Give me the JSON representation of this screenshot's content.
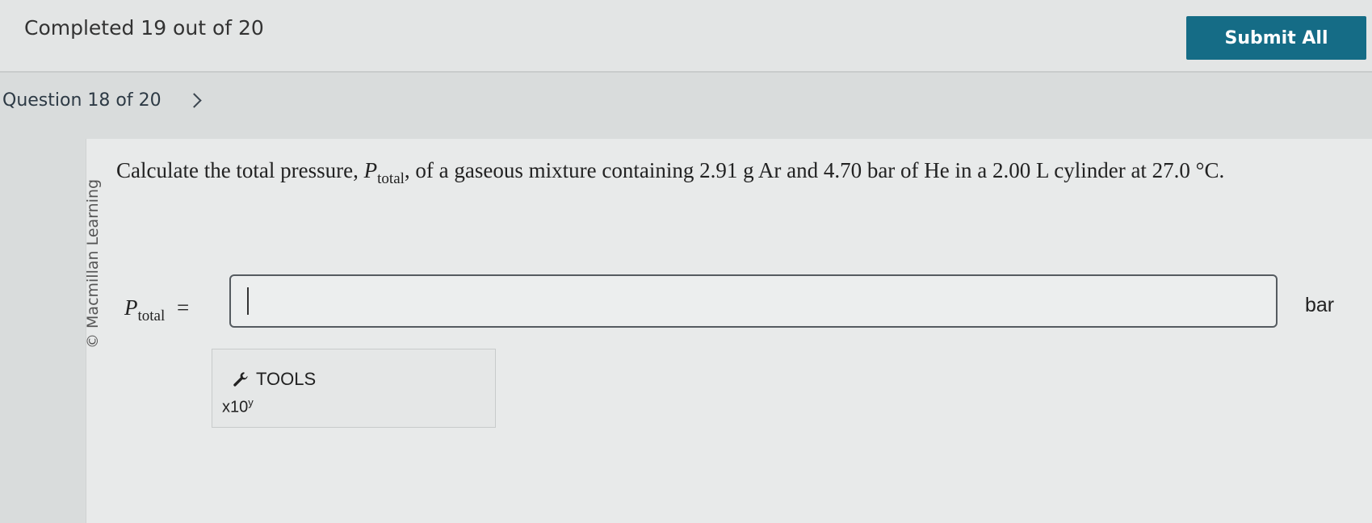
{
  "header": {
    "progress": "Completed 19 out of 20",
    "submit_label": "Submit All"
  },
  "nav": {
    "question_label": "Question 18 of 20",
    "next_icon": "chevron-right-icon"
  },
  "panel": {
    "copyright": "© Macmillan Learning",
    "question": {
      "before": "Calculate the total pressure, ",
      "symbol": "P",
      "subscript": "total",
      "after": ", of a gaseous mixture containing 2.91 g Ar and 4.70 bar of He in a 2.00 L cylinder at 27.0 °C."
    },
    "answer": {
      "symbol": "P",
      "subscript": "total",
      "equals": "=",
      "value": "",
      "unit": "bar"
    },
    "tools": {
      "label": "TOOLS",
      "icon": "wrench-icon",
      "x10_base": "x10",
      "x10_exp": "y"
    }
  },
  "colors": {
    "submit_bg": "#156c86",
    "background": "#d9dcdc"
  }
}
